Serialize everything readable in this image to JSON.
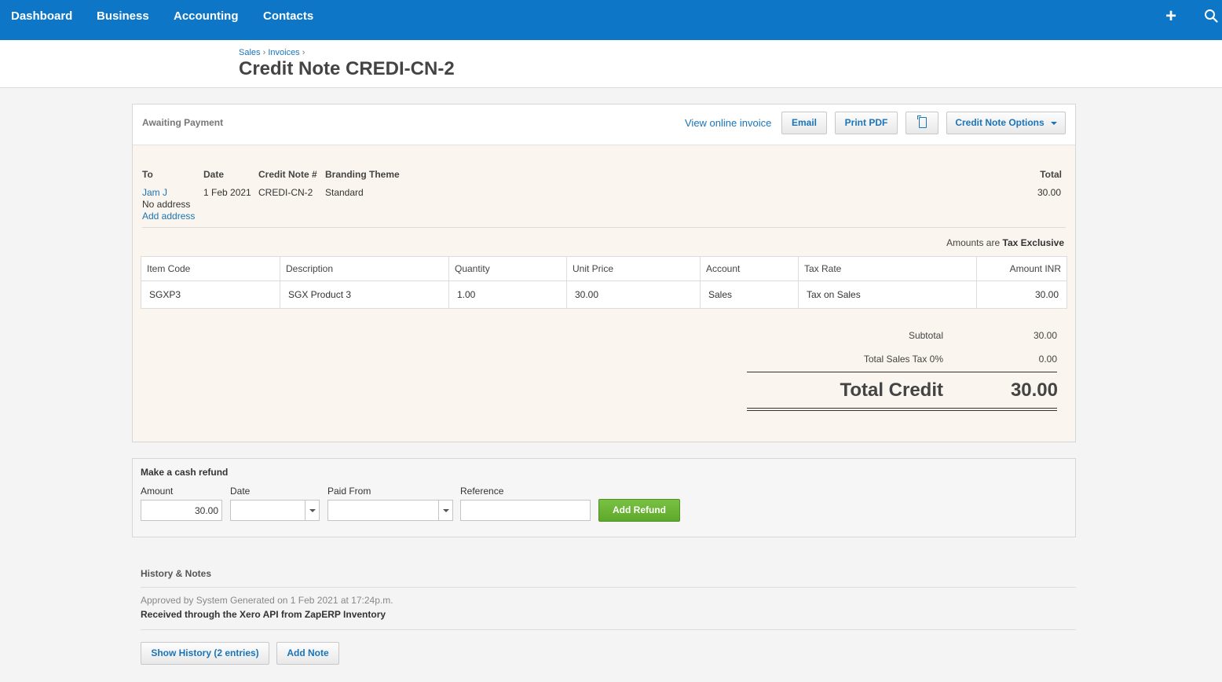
{
  "nav": {
    "items": [
      "Dashboard",
      "Business",
      "Accounting",
      "Contacts"
    ],
    "add_icon": "plus-icon",
    "search_icon": "search-icon"
  },
  "breadcrumb": {
    "sales": "Sales",
    "invoices": "Invoices",
    "sep": "›"
  },
  "page_title": "Credit Note CREDI-CN-2",
  "toolbar": {
    "status": "Awaiting Payment",
    "view_online": "View online invoice",
    "email": "Email",
    "print_pdf": "Print PDF",
    "copy_icon": "copy-icon",
    "options": "Credit Note Options"
  },
  "meta": {
    "to_label": "To",
    "date_label": "Date",
    "number_label": "Credit Note #",
    "theme_label": "Branding Theme",
    "total_label": "Total",
    "contact": "Jam J",
    "no_address": "No address",
    "add_address": "Add address",
    "date": "1 Feb 2021",
    "number": "CREDI-CN-2",
    "theme": "Standard",
    "total": "30.00"
  },
  "amounts_note": {
    "prefix": "Amounts are",
    "value": "Tax Exclusive"
  },
  "line_items": {
    "headers": [
      "Item Code",
      "Description",
      "Quantity",
      "Unit Price",
      "Account",
      "Tax Rate",
      "Amount INR"
    ],
    "rows": [
      [
        "SGXP3",
        "SGX Product 3",
        "1.00",
        "30.00",
        "Sales",
        "Tax on Sales",
        "30.00"
      ]
    ]
  },
  "totals": {
    "subtotal_label": "Subtotal",
    "subtotal": "30.00",
    "tax_label": "Total Sales Tax 0%",
    "tax": "0.00",
    "total_credit_label": "Total Credit",
    "total_credit": "30.00"
  },
  "refund": {
    "title": "Make a cash refund",
    "amount_label": "Amount",
    "amount": "30.00",
    "date_label": "Date",
    "paid_from_label": "Paid From",
    "reference_label": "Reference",
    "add_refund": "Add Refund"
  },
  "history": {
    "title": "History & Notes",
    "approved": "Approved by System Generated on 1 Feb 2021 at 17:24p.m.",
    "note": "Received through the Xero API from ZapERP Inventory",
    "show_history": "Show History (2 entries)",
    "add_note": "Add Note"
  }
}
